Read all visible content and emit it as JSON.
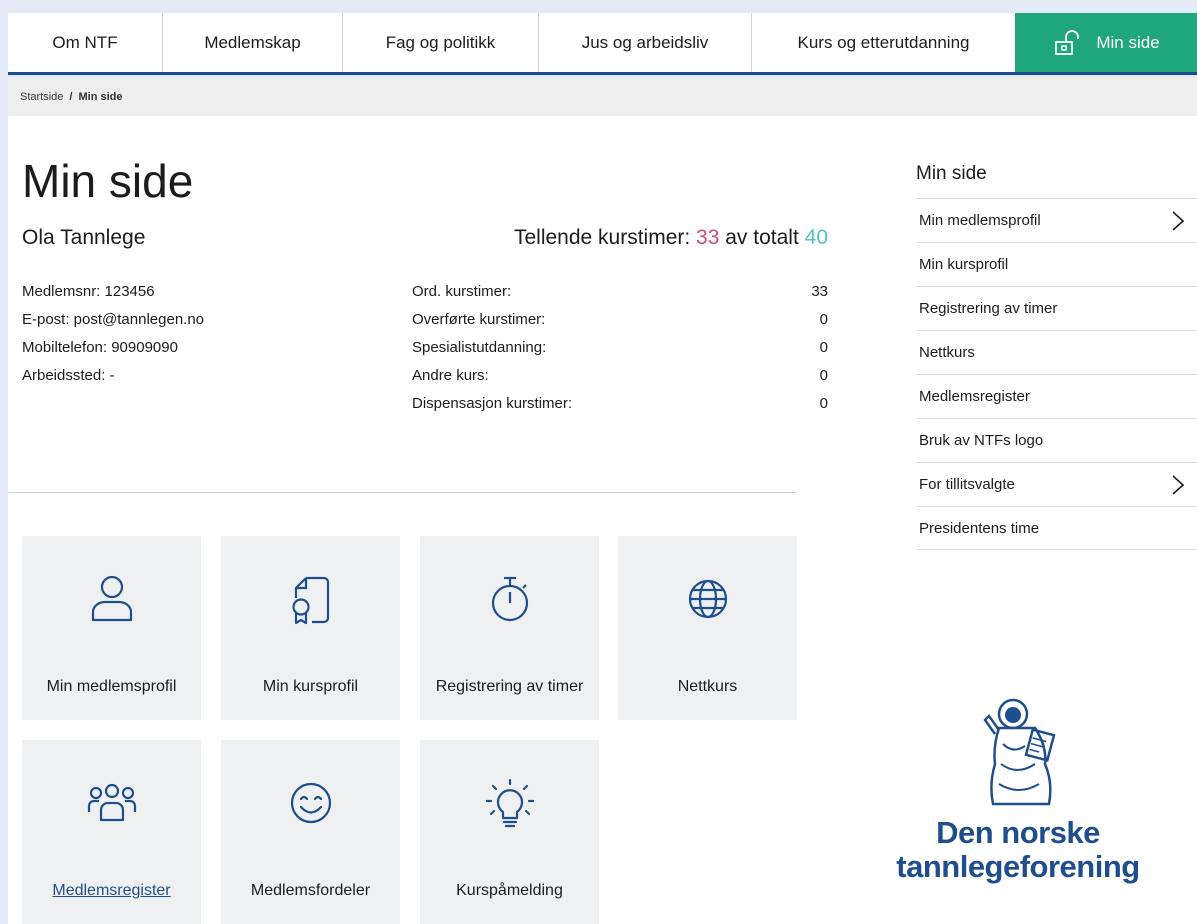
{
  "nav": {
    "items": [
      "Om NTF",
      "Medlemskap",
      "Fag og politikk",
      "Jus og arbeidsliv",
      "Kurs og etterutdanning"
    ],
    "active": "Min side",
    "accent_color": "#1fa67a",
    "active_icon": "unlock-icon"
  },
  "breadcrumb": {
    "home": "Startside",
    "separator": "/",
    "current": "Min side"
  },
  "page": {
    "title": "Min side",
    "user_name": "Ola Tannlege"
  },
  "summary": {
    "label": "Tellende kurstimer:",
    "counted": "33",
    "of_label": "av totalt",
    "total": "40",
    "counted_color": "#c8507a",
    "total_color": "#5bc0c0"
  },
  "member_info": [
    "Medlemsnr: 123456",
    "E-post: post@tannlegen.no",
    "Mobiltelefon: 90909090",
    "Arbeidssted: -"
  ],
  "hours": [
    {
      "label": "Ord. kurstimer:",
      "value": "33"
    },
    {
      "label": "Overførte kurstimer:",
      "value": "0"
    },
    {
      "label": "Spesialistutdanning:",
      "value": "0"
    },
    {
      "label": "Andre kurs:",
      "value": "0"
    },
    {
      "label": "Dispensasjon kurstimer:",
      "value": "0"
    }
  ],
  "tiles": [
    {
      "label": "Min medlemsprofil",
      "icon": "user-icon"
    },
    {
      "label": "Min kursprofil",
      "icon": "certificate-document-icon"
    },
    {
      "label": "Registrering av timer",
      "icon": "stopwatch-icon"
    },
    {
      "label": "Nettkurs",
      "icon": "globe-icon"
    },
    {
      "label": "Medlemsregister",
      "icon": "group-icon"
    },
    {
      "label": "Medlemsfordeler",
      "icon": "smiley-icon"
    },
    {
      "label": "Kurspåmelding",
      "icon": "lightbulb-icon"
    }
  ],
  "side_menu": {
    "title": "Min side",
    "items": [
      {
        "label": "Min medlemsprofil",
        "has_submenu": true
      },
      {
        "label": "Min kursprofil",
        "has_submenu": false
      },
      {
        "label": "Registrering av timer",
        "has_submenu": false
      },
      {
        "label": "Nettkurs",
        "has_submenu": false
      },
      {
        "label": "Medlemsregister",
        "has_submenu": false
      },
      {
        "label": "Bruk av NTFs logo",
        "has_submenu": false
      },
      {
        "label": "For tillitsvalgte",
        "has_submenu": true
      },
      {
        "label": "Presidentens time",
        "has_submenu": false
      }
    ]
  },
  "logo": {
    "line1": "Den norske",
    "line2": "tannlegeforening",
    "color": "#1f4e8c"
  }
}
